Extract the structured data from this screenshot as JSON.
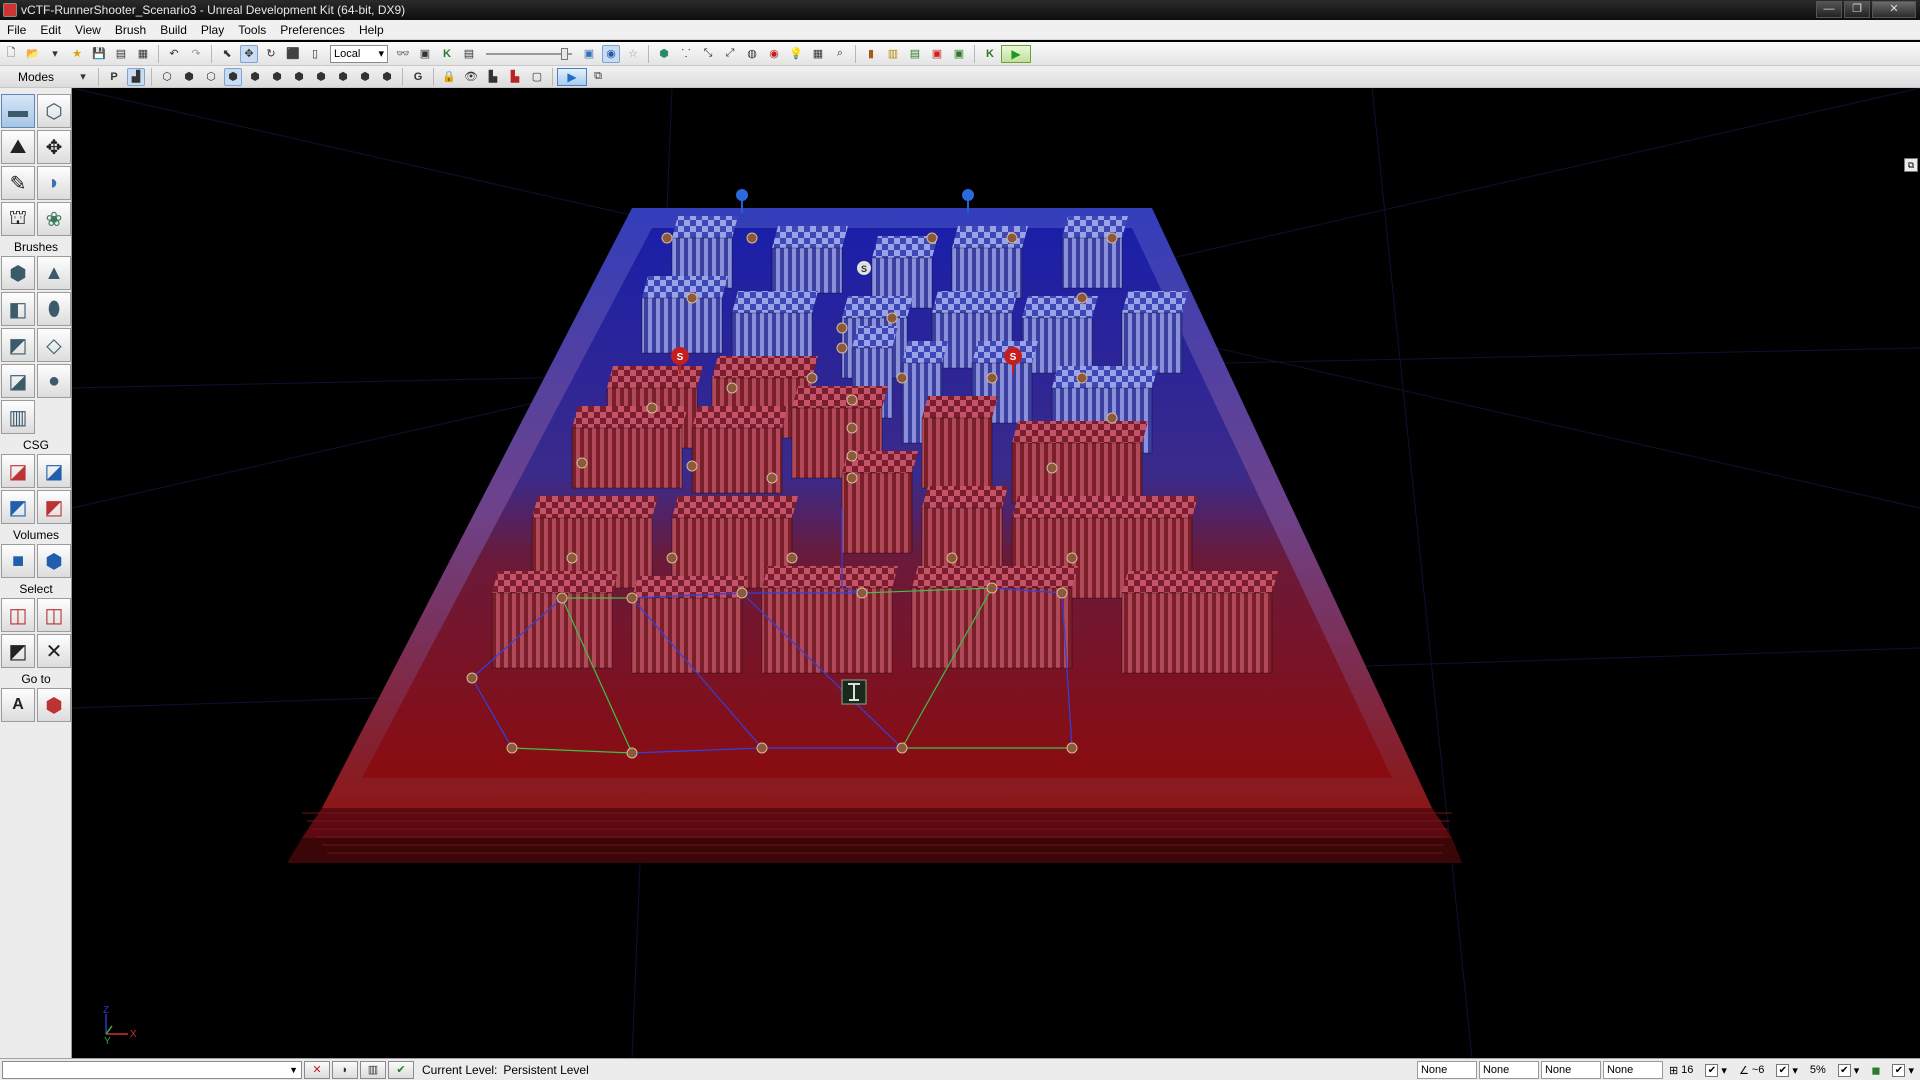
{
  "window": {
    "title": "vCTF-RunnerShooter_Scenario3 - Unreal Development Kit (64-bit, DX9)"
  },
  "menu": [
    "File",
    "Edit",
    "View",
    "Brush",
    "Build",
    "Play",
    "Tools",
    "Preferences",
    "Help"
  ],
  "toolbar": {
    "coordinate_system": "Local"
  },
  "modes_panel": {
    "title": "Modes",
    "sections": {
      "brushes": "Brushes",
      "csg": "CSG",
      "volumes": "Volumes",
      "select": "Select",
      "goto": "Go to"
    },
    "go_to_label": "A"
  },
  "viewport": {
    "red_flag_letter": "S",
    "white_flag_letter": "S",
    "axis_labels": {
      "x": "X",
      "y": "Y",
      "z": "Z"
    }
  },
  "status": {
    "current_level_label": "Current Level:",
    "current_level_value": "Persistent Level",
    "fields": [
      "None",
      "None",
      "None",
      "None"
    ],
    "grid_size": "16",
    "rotation_snap": "~6",
    "scale_snap": "5%"
  },
  "colors": {
    "accent_red": "#c41e1e",
    "accent_blue": "#2a3fd0"
  }
}
